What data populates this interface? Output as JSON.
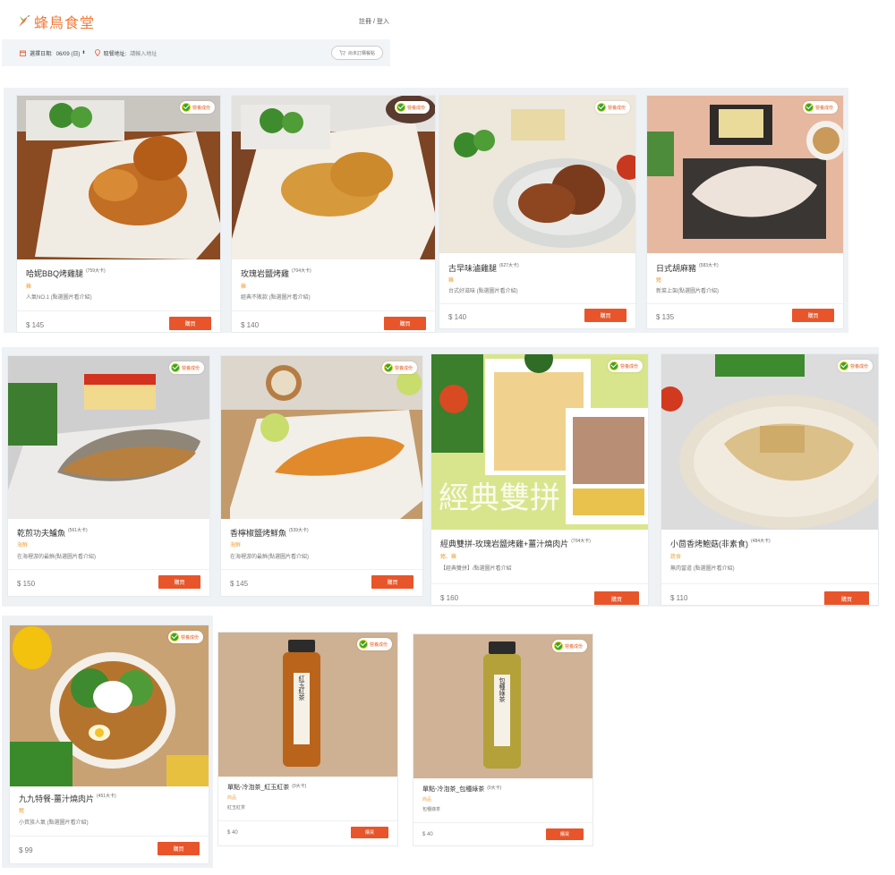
{
  "header": {
    "brand": "蜂鳥食堂",
    "auth": "註冊 / 登入"
  },
  "toolbar": {
    "date_label": "選擇日期:",
    "date_value": "06/09 (日)",
    "address_label": "取餐地址:",
    "address_placeholder": "請輸入地址",
    "cart_label": "尚未訂購餐點"
  },
  "colors": {
    "brand": "#f07a3a",
    "buy": "#e8552a",
    "tag": "#f0a340",
    "badge_green": "#2fa82f"
  },
  "products": [
    {
      "name": "哈妮BBQ烤雞腿",
      "kcal": "(759大卡)",
      "tag": "雞",
      "desc": "人氣NO.1 (點選圖片看介紹)",
      "price": "$ 145",
      "badge": "營養成份",
      "buy": "購買"
    },
    {
      "name": "玫瑰岩鹽烤雞",
      "kcal": "(704大卡)",
      "tag": "雞",
      "desc": "經典不敗款 (點選圖片看介紹)",
      "price": "$ 140",
      "badge": "營養成份",
      "buy": "購買"
    },
    {
      "name": "古早味滷雞腿",
      "kcal": "(627大卡)",
      "tag": "雞",
      "desc": "台式好滋味 (點選圖片看介紹)",
      "price": "$ 140",
      "badge": "營養成份",
      "buy": "購買"
    },
    {
      "name": "日式胡麻豬",
      "kcal": "(583大卡)",
      "tag": "豬",
      "desc": "新菜上架(點選圖片看介紹)",
      "price": "$ 135",
      "badge": "營養成份",
      "buy": "購買"
    },
    {
      "name": "乾煎功夫鱸魚",
      "kcal": "(561大卡)",
      "tag": "海鮮",
      "desc": "在海裡游的最鮮(點選圖片看介紹)",
      "price": "$ 150",
      "badge": "營養成份",
      "buy": "購買"
    },
    {
      "name": "香檸椒鹽烤鮮魚",
      "kcal": "(539大卡)",
      "tag": "海鮮",
      "desc": "在海裡游的最鮮(點選圖片看介紹)",
      "price": "$ 145",
      "badge": "營養成份",
      "buy": "購買"
    },
    {
      "name": "經典雙拼-玫瑰岩鹽烤雞+薑汁燒肉片",
      "kcal": "(704大卡)",
      "tag": "豬、雞",
      "desc": "【經典雙拼】/點選圖片看介紹",
      "price": "$ 160",
      "badge": "營養成份",
      "buy": "購買",
      "image_text": "經典雙拼"
    },
    {
      "name": "小茴香烤鮑菇(非素食)",
      "kcal": "(484大卡)",
      "tag": "蔬食",
      "desc": "無肉當道 (點選圖片看介紹)",
      "price": "$ 110",
      "badge": "營養成份",
      "buy": "購買"
    },
    {
      "name": "九九特餐-薑汁燒肉片",
      "kcal": "(451大卡)",
      "tag": "豬",
      "desc": "小資族人氣 (點選圖片看介紹)",
      "price": "$ 99",
      "badge": "營養成份",
      "buy": "購買"
    },
    {
      "name": "單點-冷泡茶_紅玉紅茶",
      "kcal": "(0大卡)",
      "tag": "商品",
      "desc": "紅玉紅茶",
      "price": "$ 40",
      "badge": "營養成份",
      "buy": "購買",
      "image_text": "紅玉紅茶"
    },
    {
      "name": "單點-冷泡茶_包種綠茶",
      "kcal": "(0大卡)",
      "tag": "商品",
      "desc": "包種綠茶",
      "price": "$ 40",
      "badge": "營養成份",
      "buy": "購買",
      "image_text": "包種綠茶"
    }
  ]
}
